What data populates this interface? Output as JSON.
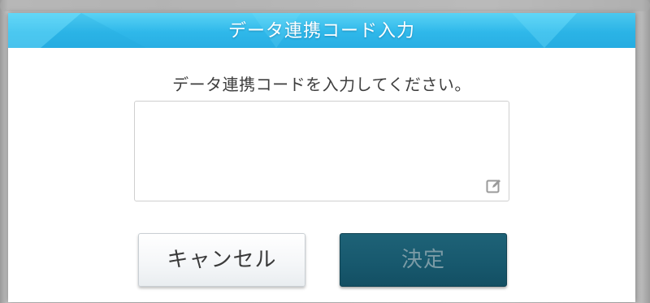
{
  "dialog": {
    "title": "データ連携コード入力",
    "instruction": "データ連携コードを入力してください。",
    "code_input": {
      "value": "",
      "placeholder": ""
    },
    "buttons": {
      "cancel_label": "キャンセル",
      "ok_label": "決定"
    }
  },
  "icons": {
    "edit": "pencil-edit-icon"
  },
  "colors": {
    "header_blue": "#2fb8ea",
    "ok_button": "#17586d",
    "ok_text_disabled": "#7a9aa5",
    "cancel_button": "#f4f6f8"
  }
}
